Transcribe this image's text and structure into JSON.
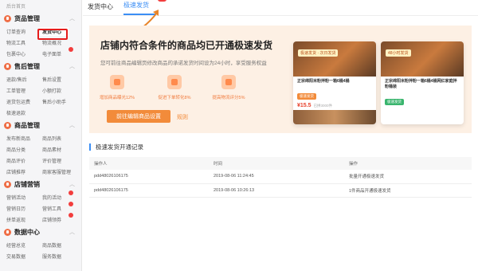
{
  "sidebar": {
    "top_label": "后台首页",
    "sections": [
      {
        "title": "货品管理",
        "rows": [
          [
            "订单查询",
            "发货中心"
          ],
          [
            "物流工具",
            "物流概况"
          ],
          [
            "包裹中心",
            "电子面单"
          ]
        ]
      },
      {
        "title": "售后管理",
        "rows": [
          [
            "退款/售后",
            "售后设置"
          ],
          [
            "工单管理",
            "小额打款"
          ],
          [
            "退货包运费",
            "售后小助手"
          ],
          [
            "极速退款",
            ""
          ]
        ]
      },
      {
        "title": "商品管理",
        "rows": [
          [
            "发布新商品",
            "商品列表"
          ],
          [
            "商品分类",
            "商品素材"
          ],
          [
            "商品评价",
            "评价管理"
          ],
          [
            "店铺推荐",
            "商家客服管理"
          ]
        ]
      },
      {
        "title": "店铺营销",
        "rows": [
          [
            "营销活动",
            "我的活动"
          ],
          [
            "营销日历",
            "营销工具"
          ],
          [
            "拼单返现",
            "店铺领券"
          ]
        ]
      },
      {
        "title": "数据中心",
        "rows": [
          [
            "经营总览",
            "商品数据"
          ],
          [
            "交易数据",
            "服务数据"
          ]
        ]
      }
    ]
  },
  "tabs": [
    {
      "label": "发货中心"
    },
    {
      "label": "极速发货",
      "badge": "new"
    }
  ],
  "banner": {
    "title": "店铺内符合条件的商品均已开通极速发货",
    "subtitle": "您可前往商品编辑页修改商品的承诺发货时间设为24小时，享受服务权益",
    "features": [
      "增加商品曝光12%",
      "促进下单转化8%",
      "提高物流评分5%"
    ],
    "button": "前往编辑商品设置",
    "rule_link": "规则"
  },
  "cards": [
    {
      "tag": "极速发货 · 次日发货",
      "title": "正宗绵阳米粉拌粉一箱6桶4桶",
      "badge": "极速发货",
      "price": "¥15.5",
      "sold": "已拼3000件"
    },
    {
      "tag": "48小时发货",
      "title": "正宗绵阳米粉拌粉一箱6桶4桶网红家庭拌粉桶装",
      "badge": "极速发货"
    }
  ],
  "records": {
    "title": "极速发货开通记录",
    "headers": [
      "操作人",
      "时间",
      "操作"
    ],
    "rows": [
      [
        "pdd48026106175",
        "2019-08-06 11:24:45",
        "批量开通极速发货"
      ],
      [
        "pdd48026106175",
        "2019-08-06 10:26:13",
        "1件商品开通极速发货"
      ]
    ]
  },
  "colors": {
    "accent": "#3b8ef5",
    "orange": "#f28b3a",
    "highlight_red": "#e51c1c"
  }
}
